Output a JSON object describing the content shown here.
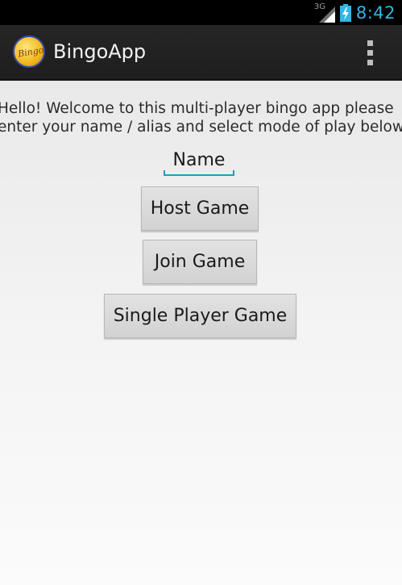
{
  "status_bar": {
    "network_type": "3G",
    "time": "8:42",
    "icons": [
      "signal-icon",
      "battery-charging-icon"
    ]
  },
  "action_bar": {
    "logo_text": "Bingo",
    "title": "BingoApp",
    "menu_icon": "overflow-menu-icon"
  },
  "main": {
    "welcome_line1": "Hello! Welcome to this multi-player bingo app please",
    "welcome_line2": "enter your name / alias and select mode of play below:",
    "name_placeholder": "Name",
    "host_button": "Host Game",
    "join_button": "Join Game",
    "single_button": "Single Player Game"
  },
  "colors": {
    "accent": "#33b5e5",
    "input_underline": "#1b9fc4",
    "action_bar": "#222222"
  }
}
